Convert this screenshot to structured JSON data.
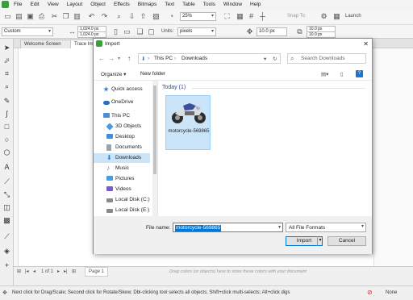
{
  "menubar": {
    "items": [
      "File",
      "Edit",
      "View",
      "Layout",
      "Object",
      "Effects",
      "Bitmaps",
      "Text",
      "Table",
      "Tools",
      "Window",
      "Help"
    ]
  },
  "toolbar": {
    "zoom_value": "25%",
    "snap_to_label": "Snap To",
    "launch_label": "Launch"
  },
  "propertybar": {
    "preset": "Custom",
    "width_value": "1,024.0 px",
    "height_value": "1,024.0 px",
    "units_label": "Units:",
    "units_value": "pixels",
    "nudge_value": "10.0 px",
    "dup_x": "10.0 px",
    "dup_y": "10.0 px"
  },
  "doc_tabs": [
    "Welcome Screen",
    "Trace Im"
  ],
  "pagebar": {
    "page_info": "1 of 1",
    "page_tab": "Page 1",
    "hint": "Drag colors (or objects) here to store these colors with your document"
  },
  "statusbar": {
    "message": "Next click for Drag/Scale; Second click for Rotate/Skew; Dbl-clicking tool selects all objects; Shift+click multi-selects; Alt+click digs",
    "fill_label": "None"
  },
  "dialog": {
    "title": "Import",
    "breadcrumb": [
      "This PC",
      "Downloads"
    ],
    "search_placeholder": "Search Downloads",
    "organize_label": "Organize ▾",
    "new_folder_label": "New folder",
    "nav_items": [
      {
        "label": "Quick access",
        "icon": "star-icon",
        "color": "#2f7fd8",
        "indent": 0
      },
      {
        "label": "OneDrive",
        "icon": "cloud-icon",
        "color": "#1f73d1",
        "indent": 0
      },
      {
        "label": "This PC",
        "icon": "computer-icon",
        "color": "#4a8fd6",
        "indent": 0
      },
      {
        "label": "3D Objects",
        "icon": "cube-icon",
        "color": "#4b9be0",
        "indent": 1
      },
      {
        "label": "Desktop",
        "icon": "desktop-icon",
        "color": "#3d8ee0",
        "indent": 1
      },
      {
        "label": "Documents",
        "icon": "documents-icon",
        "color": "#9aa4ad",
        "indent": 1
      },
      {
        "label": "Downloads",
        "icon": "download-icon",
        "color": "#2f7fd8",
        "indent": 1
      },
      {
        "label": "Music",
        "icon": "music-icon",
        "color": "#3b7fd1",
        "indent": 1
      },
      {
        "label": "Pictures",
        "icon": "pictures-icon",
        "color": "#4b9be0",
        "indent": 1
      },
      {
        "label": "Videos",
        "icon": "videos-icon",
        "color": "#7a5cc7",
        "indent": 1
      },
      {
        "label": "Local Disk (C:)",
        "icon": "drive-icon",
        "color": "#8a8a8a",
        "indent": 1
      },
      {
        "label": "Local Disk (E:)",
        "icon": "drive-icon",
        "color": "#8a8a8a",
        "indent": 1
      }
    ],
    "group_header": "Today (1)",
    "file": {
      "name": "motorcycle-569865"
    },
    "file_name_label": "File name:",
    "file_name_value": "motorcycle-569865",
    "file_type": "All File Formats",
    "import_label": "Import",
    "cancel_label": "Cancel"
  }
}
